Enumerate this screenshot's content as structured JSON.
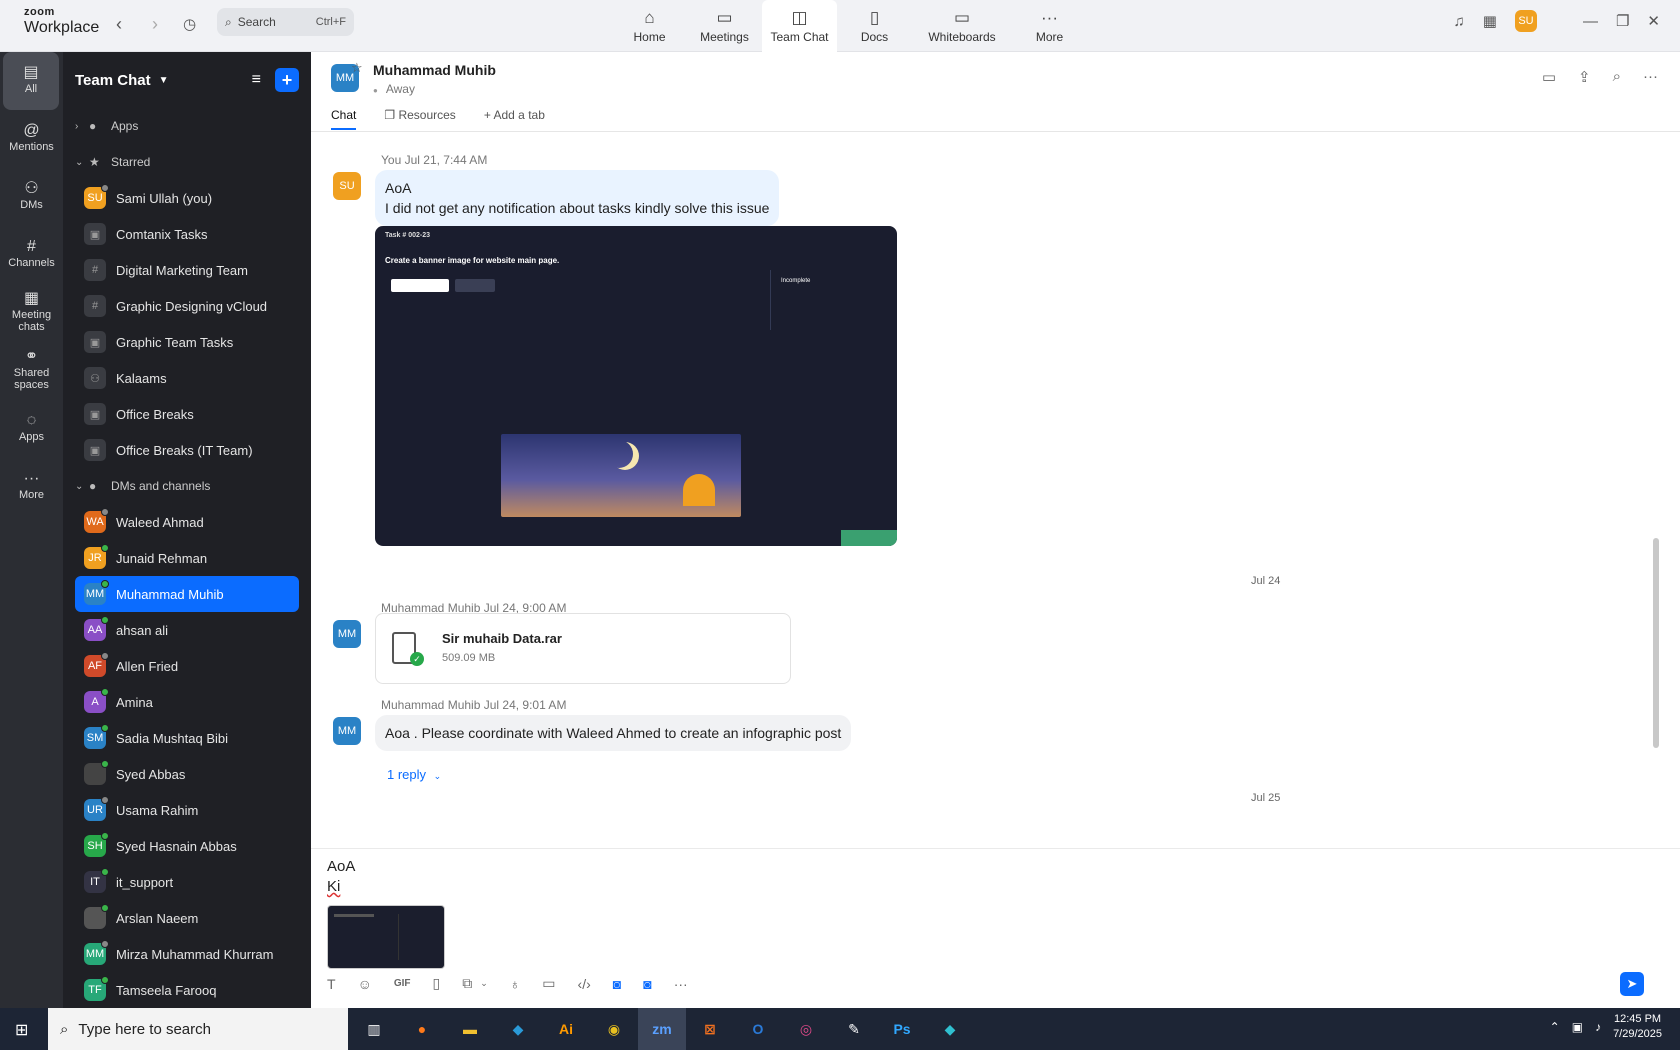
{
  "app": {
    "brand_line1": "zoom",
    "brand_line2": "Workplace"
  },
  "search": {
    "label": "Search",
    "shortcut": "Ctrl+F"
  },
  "topnav": [
    {
      "label": "Home",
      "icon": "home-icon"
    },
    {
      "label": "Meetings",
      "icon": "video-icon"
    },
    {
      "label": "Team Chat",
      "icon": "chat-icon",
      "active": true
    },
    {
      "label": "Docs",
      "icon": "doc-icon"
    },
    {
      "label": "Whiteboards",
      "icon": "whiteboard-icon"
    },
    {
      "label": "More",
      "icon": "more-icon"
    }
  ],
  "user_avatar": {
    "initials": "SU",
    "color": "#f0a020"
  },
  "rail": [
    {
      "label": "All",
      "active": true
    },
    {
      "label": "Mentions"
    },
    {
      "label": "DMs"
    },
    {
      "label": "Channels"
    },
    {
      "label": "Meeting chats"
    },
    {
      "label": "Shared spaces"
    },
    {
      "label": "Apps"
    },
    {
      "label": "More"
    }
  ],
  "sidebar": {
    "title": "Team Chat",
    "sections": {
      "apps": "Apps",
      "starred": "Starred",
      "dms": "DMs and channels"
    },
    "starred": [
      {
        "name": "Sami Ullah (you)",
        "initials": "SU",
        "color": "#f0a020",
        "type": "user"
      },
      {
        "name": "Comtanix Tasks",
        "type": "lock"
      },
      {
        "name": "Digital Marketing Team",
        "type": "hash"
      },
      {
        "name": "Graphic Designing vCloud",
        "type": "hash"
      },
      {
        "name": "Graphic Team Tasks",
        "type": "lock"
      },
      {
        "name": "Kalaams",
        "type": "group"
      },
      {
        "name": "Office Breaks",
        "type": "lock"
      },
      {
        "name": "Office Breaks (IT Team)",
        "type": "lock"
      }
    ],
    "dms": [
      {
        "name": "Waleed Ahmad",
        "initials": "WA",
        "color": "#e06a1b"
      },
      {
        "name": "Junaid Rehman",
        "initials": "JR",
        "color": "#f0a020"
      },
      {
        "name": "Muhammad Muhib",
        "initials": "MM",
        "color": "#2a82c6",
        "selected": true
      },
      {
        "name": "ahsan ali",
        "initials": "AA",
        "color": "#8a4fc6"
      },
      {
        "name": "Allen Fried",
        "initials": "AF",
        "color": "#d04a2a"
      },
      {
        "name": "Amina",
        "initials": "A",
        "color": "#8a4fc6"
      },
      {
        "name": "Sadia Mushtaq Bibi",
        "initials": "SM",
        "color": "#2a82c6"
      },
      {
        "name": "Syed Abbas",
        "initials": "",
        "color": "#444"
      },
      {
        "name": "Usama Rahim",
        "initials": "UR",
        "color": "#2a82c6"
      },
      {
        "name": "Syed Hasnain Abbas",
        "initials": "SH",
        "color": "#27a84a"
      },
      {
        "name": "it_support",
        "initials": "IT",
        "color": "#334"
      },
      {
        "name": "Arslan Naeem",
        "initials": "",
        "color": "#555"
      },
      {
        "name": "Mirza Muhammad Khurram",
        "initials": "MM",
        "color": "#27a878"
      },
      {
        "name": "Tamseela Farooq",
        "initials": "TF",
        "color": "#27a878"
      }
    ]
  },
  "chat": {
    "name": "Muhammad Muhib",
    "initials": "MM",
    "status": "Away",
    "tabs": [
      "Chat",
      "Resources",
      "Add a tab"
    ]
  },
  "messages": {
    "m1": {
      "sender": "You",
      "time": "Jul 21, 7:44 AM",
      "initials": "SU",
      "line1": "AoA",
      "line2": "I did not get any notification about tasks kindly solve this issue"
    },
    "screenshot": {
      "task_id": "Task # 002-23",
      "task_title": "Create a banner image for website main page.",
      "status": "Incomplete"
    },
    "date_jul24": "Jul 24",
    "m2": {
      "sender": "Muhammad Muhib",
      "time": "Jul 24, 9:00 AM",
      "initials": "MM",
      "file_name": "Sir muhaib Data.rar",
      "file_size": "509.09 MB"
    },
    "m3": {
      "sender": "Muhammad Muhib",
      "time": "Jul 24, 9:01 AM",
      "initials": "MM",
      "text": "Aoa . Please coordinate with Waleed Ahmed to create an infographic post",
      "reply": "1 reply"
    },
    "date_jul25": "Jul 25"
  },
  "composer": {
    "line1": "AoA",
    "line2": "Ki"
  },
  "taskbar": {
    "search_placeholder": "Type here to search",
    "time": "12:45 PM",
    "date": "7/29/2025"
  },
  "colors": {
    "accent": "#0b6cff",
    "sidebar_bg": "#1f2025",
    "rail_bg": "#2b2d33"
  }
}
